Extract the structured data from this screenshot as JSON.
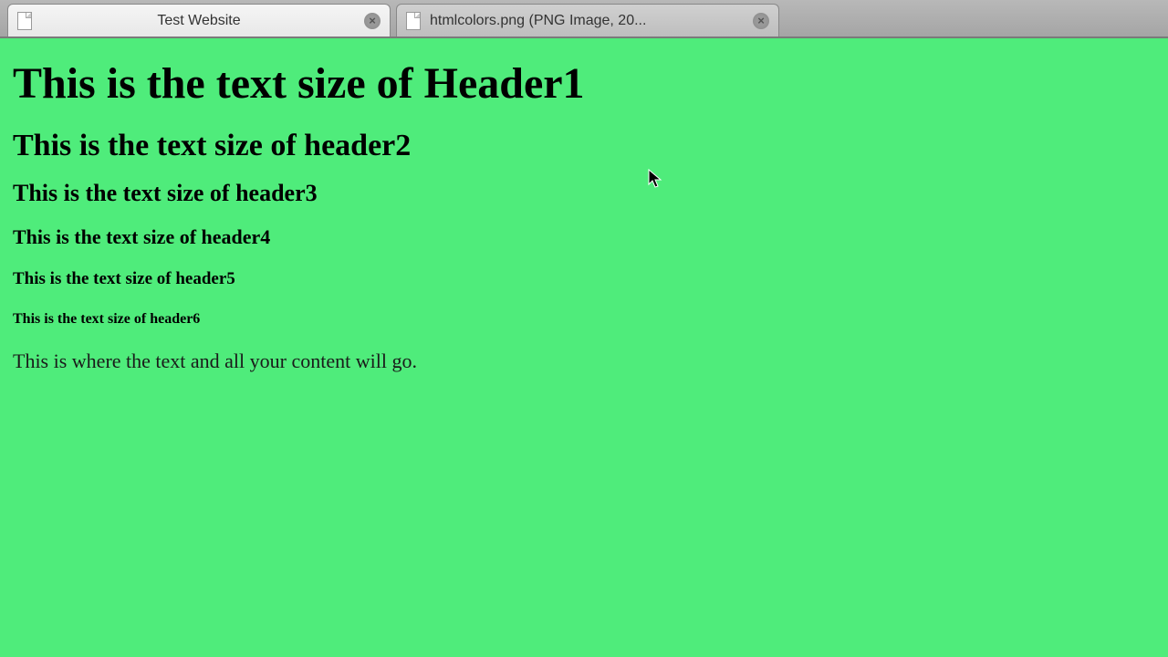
{
  "tabs": [
    {
      "title": "Test Website",
      "active": true
    },
    {
      "title": "htmlcolors.png (PNG Image, 20...",
      "active": false
    }
  ],
  "page": {
    "h1": "This is the text size of Header1",
    "h2": "This is the text size of header2",
    "h3": "This is the text size of header3",
    "h4": "This is the text size of header4",
    "h5": "This is the text size of header5",
    "h6": "This is the text size of header6",
    "paragraph": "This is where the text and all your content will go."
  },
  "colors": {
    "page_bg": "#4fec7b"
  }
}
